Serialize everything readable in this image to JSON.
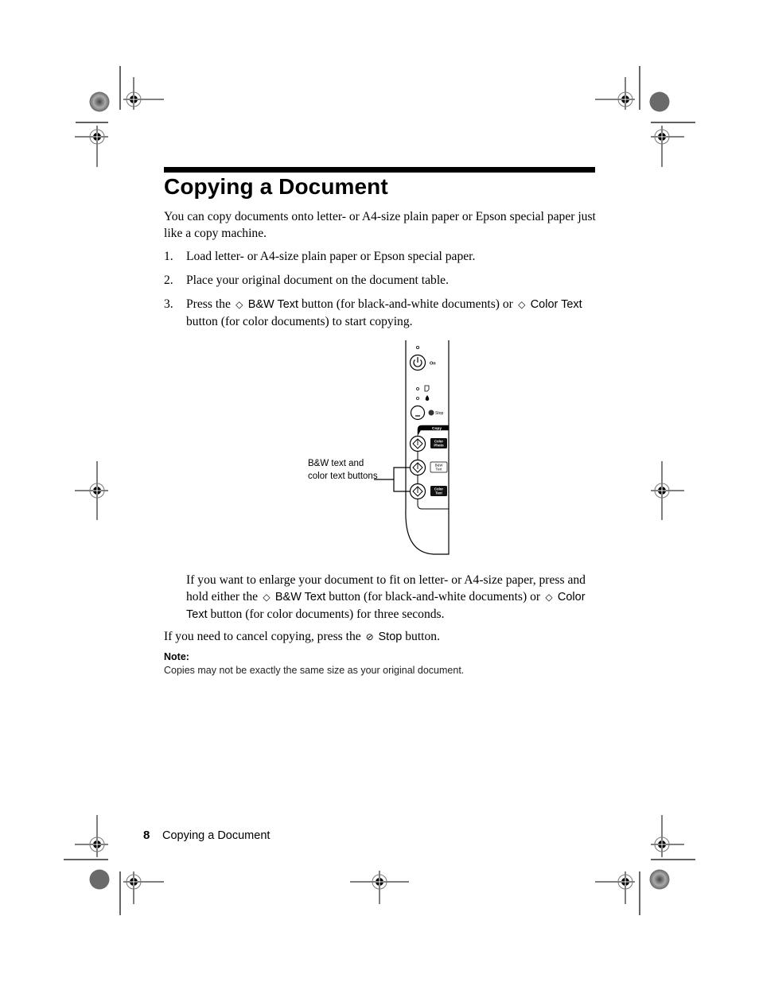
{
  "page": {
    "title": "Copying a Document",
    "intro": "You can copy documents onto letter- or A4-size plain paper or Epson special paper just like a copy machine.",
    "steps": [
      {
        "number": "1.",
        "text": "Load letter- or A4-size plain paper or Epson special paper."
      },
      {
        "number": "2.",
        "text": "Place your original document on the document table."
      },
      {
        "number": "3.",
        "parts": {
          "a": "Press the",
          "b": "B&W Text",
          "c": "button (for black-and-white documents) or",
          "d": "Color Text",
          "e": "button (for color documents) to start copying."
        }
      }
    ],
    "figure": {
      "callout": "B&W text and color text buttons",
      "panel": {
        "on_label": "On",
        "stop_label": "Stop",
        "copy_label": "Copy",
        "color_photo_label": [
          "Color",
          "Photo"
        ],
        "bw_text_label": [
          "B&W",
          "Text"
        ],
        "color_text_label": [
          "Color",
          "Text"
        ]
      }
    },
    "enlarge": {
      "a": "If you want to enlarge your document to fit on letter- or A4-size paper, press and hold either the",
      "b": "B&W Text",
      "c": "button (for black-and-white documents) or",
      "d": "Color Text",
      "e": "button (for color documents) for three seconds."
    },
    "cancel": {
      "a": "If you need to cancel copying, press the",
      "b": "Stop",
      "c": "button."
    },
    "note": {
      "label": "Note:",
      "text": "Copies may not be exactly the same size as your original document."
    },
    "footer": {
      "page_number": "8",
      "section_title": "Copying a Document"
    },
    "icons": {
      "start": "◇",
      "stop": "⊘"
    }
  }
}
